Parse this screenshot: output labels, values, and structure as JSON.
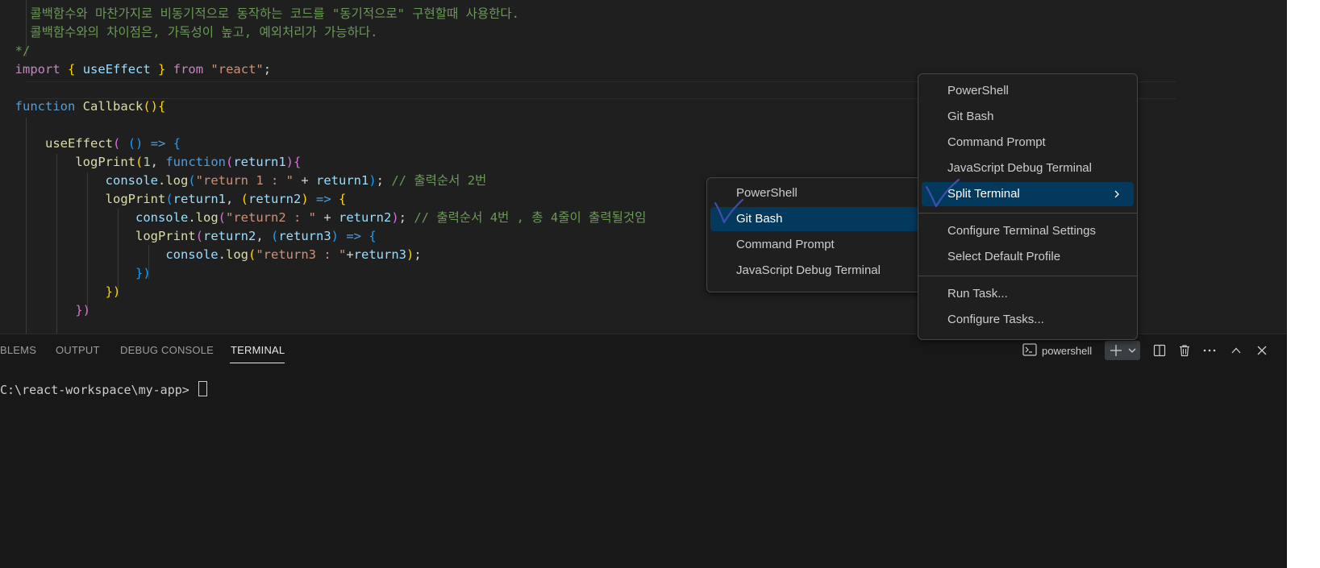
{
  "editor": {
    "comment_line1": "콜백함수와 마찬가지로 비동기적으로 동작하는 코드를 \"동기적으로\" 구현할때 사용한다.",
    "comment_line2": "콜백함수와의 차이점은, 가독성이 높고, 예외처리가 가능하다.",
    "comment_close": "*/",
    "import_kw": "import",
    "import_name": "useEffect",
    "from_kw": "from",
    "import_src": "\"react\"",
    "function_kw": "function",
    "function_name": "Callback",
    "use_effect": "useEffect",
    "arrow": "=>",
    "log_print": "logPrint",
    "num_one": "1",
    "function_kw2": "function",
    "param1": "return1",
    "param2": "return2",
    "param3": "return3",
    "console": "console",
    "log": "log",
    "str1": "\"return 1 : \"",
    "str2": "\"return2 : \"",
    "str3": "\"return3 : \"",
    "comment_order2": "// 출력순서 2번",
    "comment_order4": "// 출력순서 4번 , 총 4줄이 출력될것임"
  },
  "panel": {
    "tabs": [
      "BLEMS",
      "OUTPUT",
      "DEBUG CONSOLE",
      "TERMINAL"
    ],
    "active_tab": "TERMINAL",
    "terminal_profile": "powershell",
    "prompt": "C:\\react-workspace\\my-app> "
  },
  "icons": {
    "terminal_profile": "terminal-icon",
    "add": "plus-icon",
    "dropdown": "chevron-down-icon",
    "split": "split-icon",
    "trash": "trash-icon",
    "more": "ellipsis-icon",
    "maximize": "chevron-up-icon",
    "close": "close-icon",
    "submenu": "chevron-right-icon"
  },
  "launch_menu": {
    "items": [
      "PowerShell",
      "Git Bash",
      "Command Prompt",
      "JavaScript Debug Terminal",
      "Split Terminal",
      "Configure Terminal Settings",
      "Select Default Profile",
      "Run Task...",
      "Configure Tasks..."
    ],
    "highlighted": "Split Terminal"
  },
  "split_submenu": {
    "items": [
      "PowerShell",
      "Git Bash",
      "Command Prompt",
      "JavaScript Debug Terminal"
    ],
    "highlighted": "Git Bash"
  },
  "colors": {
    "editor_bg": "#1f1f1f",
    "panel_bg": "#181818",
    "menu_highlight": "#04395e",
    "comment": "#6a9955",
    "keyword": "#569cd6",
    "string": "#ce9178",
    "checkmark": "#3d4fa8"
  }
}
